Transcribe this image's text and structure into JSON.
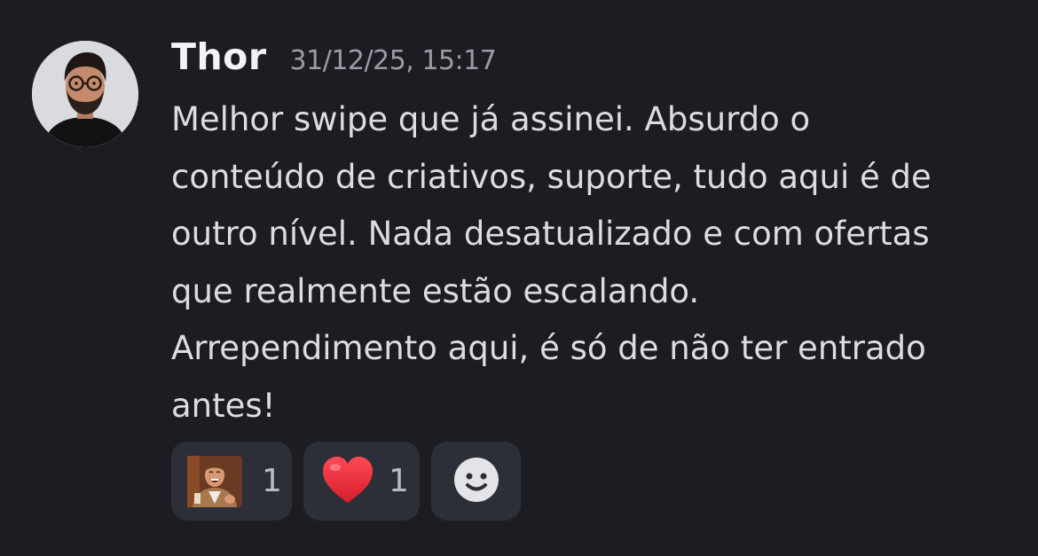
{
  "message": {
    "author": "Thor",
    "timestamp": "31/12/25, 15:17",
    "lines": [
      "Melhor swipe que já assinei. Absurdo o",
      "conteúdo de criativos, suporte, tudo aqui é de",
      "outro nível. Nada desatualizado e com ofertas",
      "que realmente estão escalando.",
      "Arrependimento aqui, é só de não ter entrado",
      "antes!"
    ]
  },
  "reactions": [
    {
      "emoji": "laughing-man-sticker-icon",
      "count": "1"
    },
    {
      "emoji": "red-heart-icon",
      "count": "1"
    },
    {
      "emoji": "add-reaction-icon"
    }
  ],
  "colors": {
    "background": "#1c1d23",
    "username": "#f2f3f5",
    "timestamp": "#9a9ca6",
    "text": "#dcdde2",
    "reaction_bg": "#2d2f38",
    "heart": "#e0263a"
  }
}
